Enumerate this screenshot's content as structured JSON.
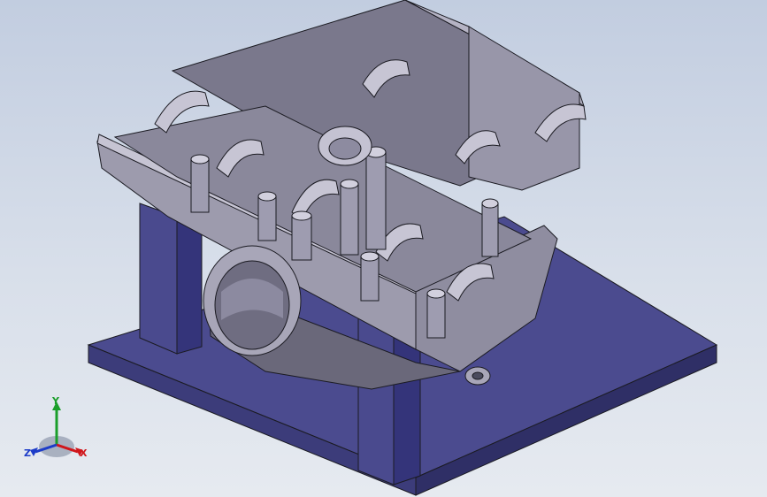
{
  "viewport": {
    "background": "#d3dbe8",
    "colors": {
      "base_plate": "#4b4b8f",
      "base_plate_edge": "#2e2e66",
      "housing_light": "#a9a7b8",
      "housing_mid": "#8c8a9c",
      "housing_dark": "#5d5b6c",
      "edge_line": "#1b1b22"
    }
  },
  "model": {
    "parts": [
      "engine-block-housing",
      "support-column-left",
      "support-column-right",
      "base-plate"
    ]
  },
  "triad": {
    "x_label": "X",
    "y_label": "Y",
    "z_label": "Z",
    "x_color": "#d0161b",
    "y_color": "#1a9e2a",
    "z_color": "#1d3cc8"
  }
}
